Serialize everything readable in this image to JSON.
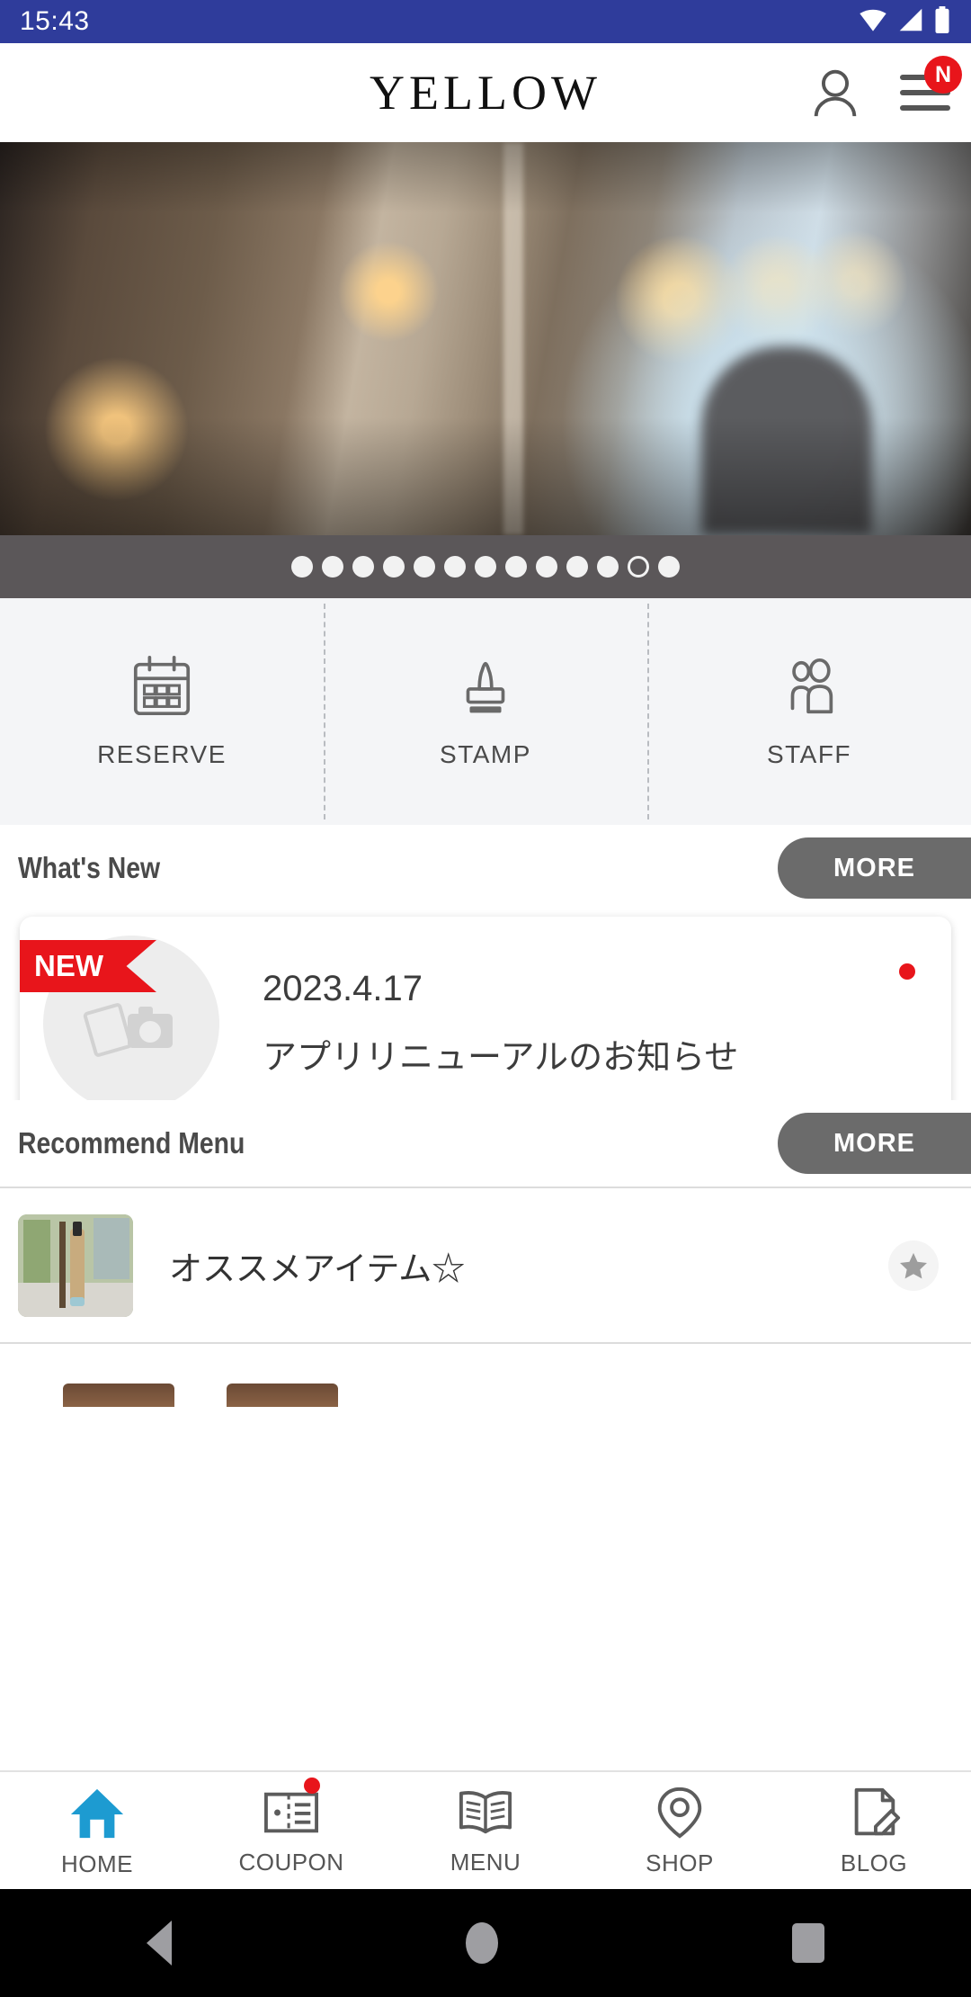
{
  "status_bar": {
    "time": "15:43",
    "icons": [
      "wifi-icon",
      "signal-icon",
      "battery-icon"
    ],
    "background_color": "#2f3c9b"
  },
  "header": {
    "brand": "YELLOW",
    "account_icon": "person-icon",
    "menu_icon": "hamburger-menu-icon",
    "menu_badge": "N",
    "badge_color": "#e8151b"
  },
  "carousel": {
    "total_dots": 13,
    "active_index": 11
  },
  "quick_actions": [
    {
      "label": "RESERVE",
      "icon": "calendar-icon"
    },
    {
      "label": "STAMP",
      "icon": "stamp-icon"
    },
    {
      "label": "STAFF",
      "icon": "people-icon"
    }
  ],
  "whats_new": {
    "title": "What's New",
    "more_label": "MORE",
    "items": [
      {
        "badge": "NEW",
        "date": "2023.4.17",
        "text": "アプリリニューアルのお知らせ",
        "unread": true,
        "thumb_icon": "photo-placeholder-icon"
      }
    ]
  },
  "recommend_menu": {
    "title": "Recommend Menu",
    "more_label": "MORE",
    "items": [
      {
        "title": "オススメアイテム☆",
        "favorite_icon": "star-icon"
      }
    ]
  },
  "bottom_nav": [
    {
      "label": "HOME",
      "icon": "home-icon",
      "active": true,
      "badge": false
    },
    {
      "label": "COUPON",
      "icon": "ticket-icon",
      "active": false,
      "badge": true
    },
    {
      "label": "MENU",
      "icon": "book-icon",
      "active": false,
      "badge": false
    },
    {
      "label": "SHOP",
      "icon": "map-pin-icon",
      "active": false,
      "badge": false
    },
    {
      "label": "BLOG",
      "icon": "document-pencil-icon",
      "active": false,
      "badge": false
    }
  ],
  "android_nav": {
    "back": "back-triangle-icon",
    "home": "home-circle-icon",
    "recents": "recents-square-icon"
  },
  "colors": {
    "accent_blue": "#1d9bd1",
    "status_blue": "#2f3c9b",
    "red": "#e8151b",
    "gray_button": "#6b6b6b"
  }
}
